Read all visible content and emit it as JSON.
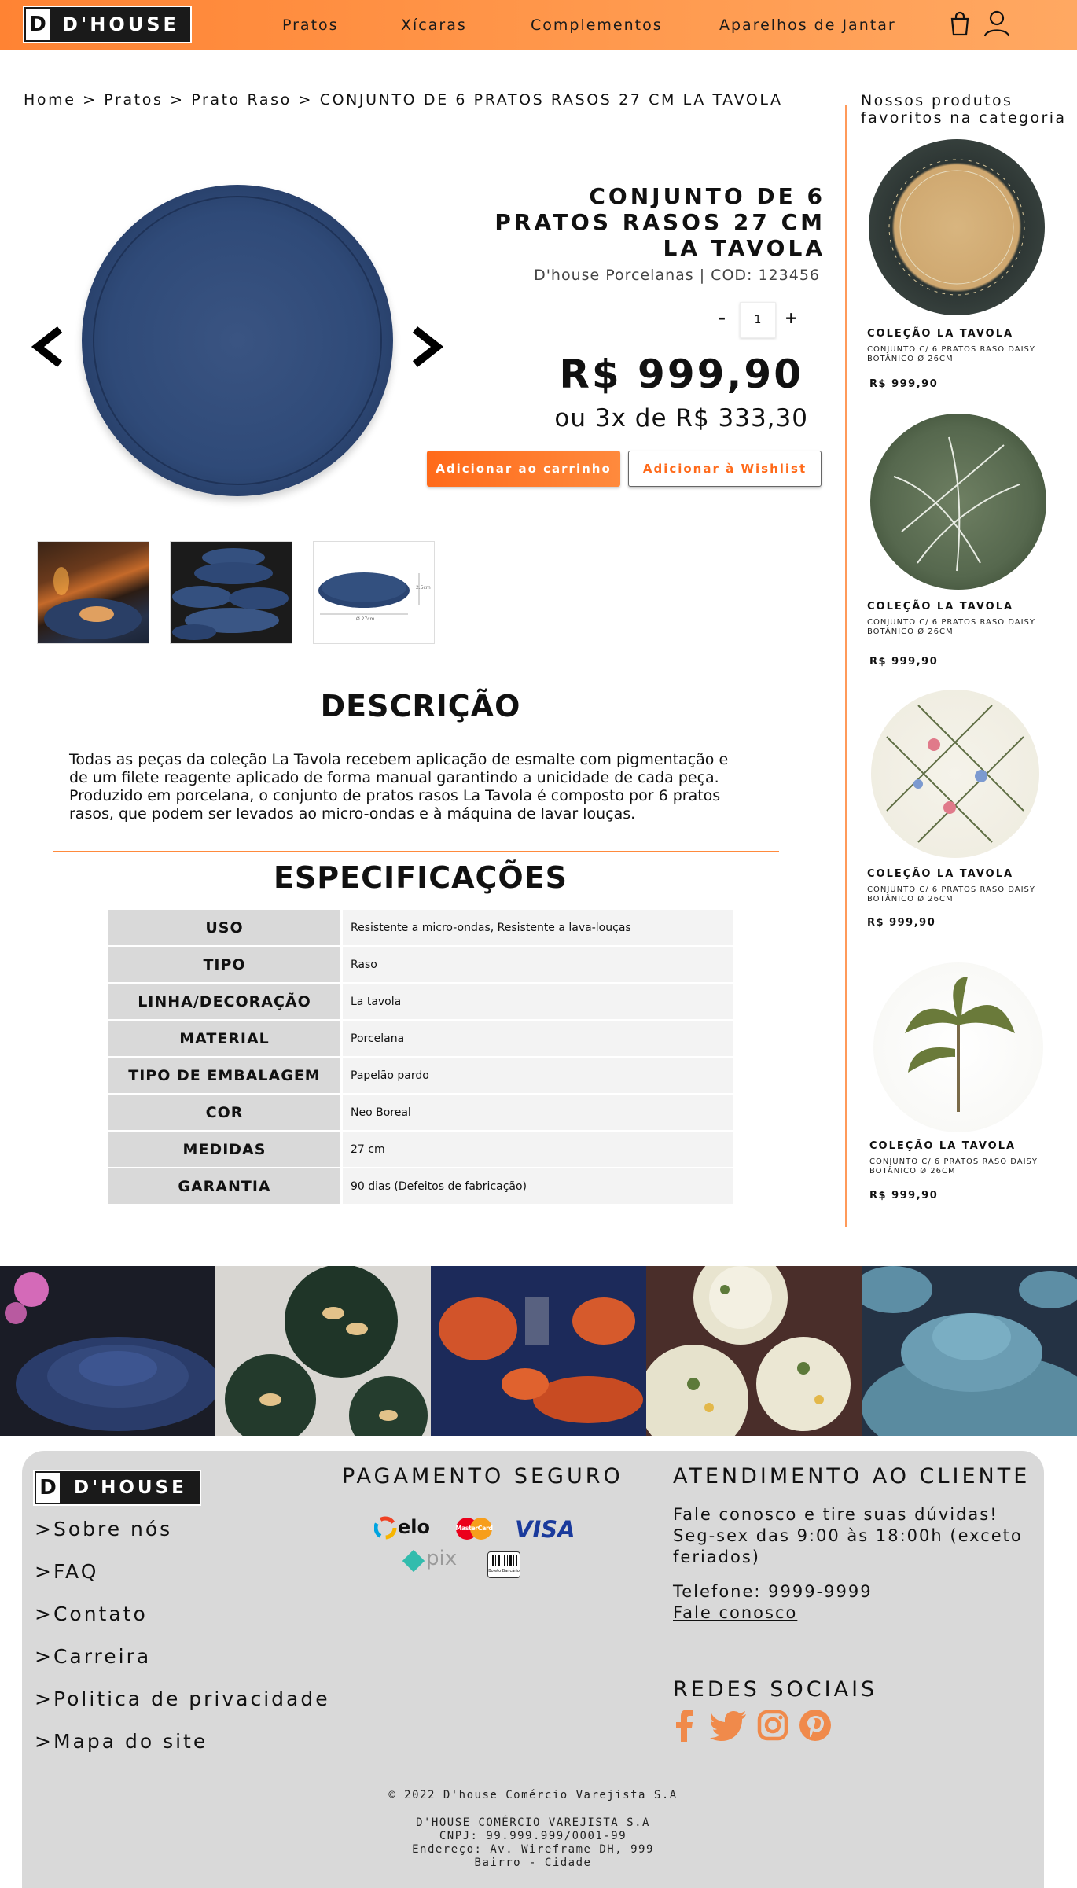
{
  "header": {
    "logo_letter": "D",
    "logo_text": "D'HOUSE",
    "nav": [
      "Pratos",
      "Xícaras",
      "Complementos",
      "Aparelhos de Jantar"
    ]
  },
  "breadcrumb": "Home > Pratos > Prato Raso > CONJUNTO DE 6 PRATOS RASOS 27 CM LA TAVOLA",
  "product": {
    "title_lines": [
      "CONJUNTO DE 6",
      "PRATOS RASOS 27 CM",
      "LA TAVOLA"
    ],
    "subtitle": "D'house Porcelanas | COD: 123456",
    "qty_minus": "–",
    "qty_value": "1",
    "qty_plus": "+",
    "price": "R$ 999,90",
    "installments": "ou 3x de R$ 333,30",
    "btn_cart": "Adicionar ao carrinho",
    "btn_wishlist": "Adicionar à Wishlist",
    "thumb3_dim_h": "2.5cm",
    "thumb3_dim_w": "Ø 27cm"
  },
  "description": {
    "title": "DESCRIÇÃO",
    "lines": [
      "Todas as peças da coleção La Tavola recebem aplicação de esmalte com pigmentação e",
      "de um filete reagente aplicado de forma manual garantindo a unicidade de cada peça.",
      "Produzido em porcelana, o conjunto de pratos rasos  La Tavola é composto por 6 pratos",
      "rasos, que podem ser levados ao micro-ondas e à máquina de lavar louças."
    ]
  },
  "specs": {
    "title": "ESPECIFICAÇÕES",
    "rows": [
      {
        "k": "USO",
        "v": "Resistente a micro-ondas, Resistente a lava-louças"
      },
      {
        "k": "TIPO",
        "v": " Raso"
      },
      {
        "k": "LINHA/DECORAÇÃO",
        "v": "La tavola"
      },
      {
        "k": "MATERIAL",
        "v": "Porcelana"
      },
      {
        "k": "TIPO DE EMBALAGEM",
        "v": "Papelão pardo"
      },
      {
        "k": "COR",
        "v": "Neo Boreal"
      },
      {
        "k": "MEDIDAS",
        "v": "27 cm"
      },
      {
        "k": "GARANTIA",
        "v": "90 dias (Defeitos de fabricação)"
      }
    ]
  },
  "sidebar": {
    "title_lines": [
      "Nossos produtos",
      "favoritos na categoria"
    ],
    "items": [
      {
        "collection": "COLEÇÃO LA TAVOLA",
        "desc_lines": [
          "CONJUNTO C/ 6 PRATOS RASO DAISY",
          "BOTÂNICO Ø 26CM"
        ],
        "price": "R$ 999,90"
      },
      {
        "collection": "COLEÇÃO LA TAVOLA",
        "desc_lines": [
          "CONJUNTO C/ 6 PRATOS RASO DAISY",
          "BOTÂNICO Ø 26CM"
        ],
        "price": "R$ 999,90"
      },
      {
        "collection": "COLEÇÃO LA TAVOLA",
        "desc_lines": [
          "CONJUNTO C/ 6 PRATOS RASO DAISY",
          "BOTÂNICO Ø 26CM"
        ],
        "price": "R$ 999,90"
      },
      {
        "collection": "COLEÇÃO LA TAVOLA",
        "desc_lines": [
          "CONJUNTO C/ 6 PRATOS RASO DAISY",
          "BOTÂNICO Ø 26CM"
        ],
        "price": "R$ 999,90"
      }
    ]
  },
  "footer": {
    "logo_letter": "D",
    "logo_text": "D'HOUSE",
    "links": [
      ">Sobre nós",
      ">FAQ",
      ">Contato",
      ">Carreira",
      ">Politica de privacidade",
      ">Mapa do site"
    ],
    "payment_title": "PAGAMENTO SEGURO",
    "payment_logos": {
      "elo": "elo",
      "mastercard": "MasterCard",
      "visa": "VISA",
      "pix": "pix",
      "boleto": "Boleto Bancário"
    },
    "support_title": "ATENDIMENTO AO CLIENTE",
    "support_lines": [
      "Fale conosco e tire suas dúvidas!",
      "Seg-sex das 9:00 às 18:00h (exceto",
      "feriados)"
    ],
    "phone": "Telefone: 9999-9999",
    "contact_link": "Fale conosco",
    "social_title": "REDES SOCIAIS",
    "copyright": "© 2022 D'house Comércio Varejista S.A",
    "company": "D'HOUSE COMÉRCIO VAREJISTA S.A",
    "cnpj": "CNPJ: 99.999.999/0001-99",
    "address": "Endereço: Av. Wireframe DH, 999",
    "district": "Bairro - Cidade"
  },
  "colors": {
    "accent": "#ff8333",
    "footer_bg": "#d9d9d9",
    "plate_blue": "#2f4a78"
  }
}
